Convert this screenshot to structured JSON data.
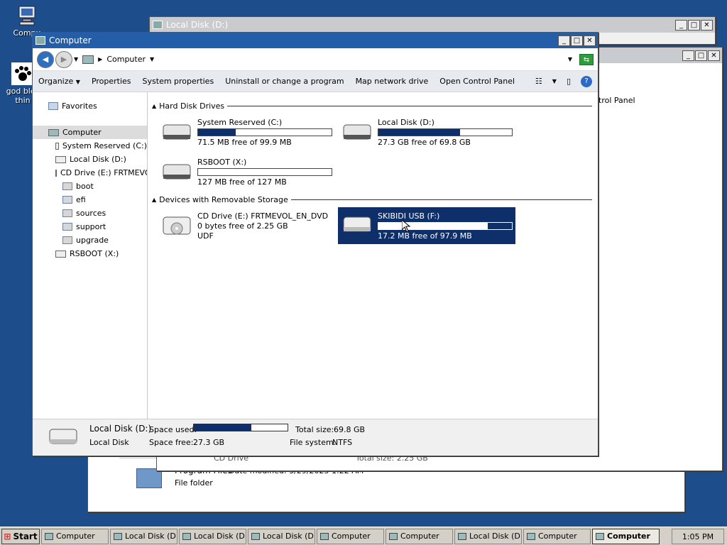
{
  "desktop": {
    "icons": [
      {
        "label": "Compu",
        "icon": "computer-icon"
      },
      {
        "label": "god bles thin",
        "icon": "paw-icon"
      }
    ]
  },
  "bg_windows": {
    "back": {
      "title": "Local Disk (D:)"
    },
    "middle_hidden_text": {
      "control_panel": "trol Panel"
    },
    "bottom": {
      "cd_drive": "CD Drive",
      "total_size": "Total size: 2.25 GB",
      "folder_name": "Program Files",
      "date_modified": "Date modified: 3/29/2025 1:22 AM",
      "folder_type": "File folder"
    }
  },
  "window": {
    "title": "Computer",
    "address": "Computer",
    "toolbar": {
      "organize": "Organize",
      "properties": "Properties",
      "system_properties": "System properties",
      "uninstall": "Uninstall or change a program",
      "map_drive": "Map network drive",
      "control_panel": "Open Control Panel"
    },
    "nav": {
      "favorites": "Favorites",
      "computer": "Computer",
      "items": [
        {
          "label": "System Reserved (C:)",
          "indent": 1,
          "kind": "drive"
        },
        {
          "label": "Local Disk (D:)",
          "indent": 1,
          "kind": "drive"
        },
        {
          "label": "CD Drive (E:) FRTMEVOL",
          "indent": 1,
          "kind": "drive"
        },
        {
          "label": "boot",
          "indent": 2,
          "kind": "folder"
        },
        {
          "label": "efi",
          "indent": 2,
          "kind": "folder"
        },
        {
          "label": "sources",
          "indent": 2,
          "kind": "folder"
        },
        {
          "label": "support",
          "indent": 2,
          "kind": "folder"
        },
        {
          "label": "upgrade",
          "indent": 2,
          "kind": "folder"
        },
        {
          "label": "RSBOOT (X:)",
          "indent": 1,
          "kind": "drive"
        }
      ]
    },
    "sections": {
      "hard_disks": "Hard Disk Drives",
      "removable": "Devices with Removable Storage"
    },
    "drives": [
      {
        "name": "System Reserved (C:)",
        "free": "71.5 MB free of 99.9 MB",
        "used_fraction": 0.28
      },
      {
        "name": "Local Disk (D:)",
        "free": "27.3 GB free of 69.8 GB",
        "used_fraction": 0.61
      },
      {
        "name": "RSBOOT (X:)",
        "free": "127 MB free of 127 MB",
        "used_fraction": 0.0
      }
    ],
    "removable": [
      {
        "name": "CD Drive (E:) FRTMEVOL_EN_DVD",
        "free": "0 bytes free of 2.25 GB",
        "fs": "UDF"
      },
      {
        "name": "SKIBIDI USB (F:)",
        "free": "17.2 MB free of 97.9 MB",
        "used_fraction": 0.82
      }
    ],
    "details": {
      "name": "Local Disk (D:)",
      "type": "Local Disk",
      "space_used_label": "Space used:",
      "space_used_fraction": 0.61,
      "space_free_label": "Space free:",
      "space_free": "27.3 GB",
      "total_size_label": "Total size:",
      "total_size": "69.8 GB",
      "fs_label": "File system:",
      "fs": "NTFS"
    }
  },
  "taskbar": {
    "start": "Start",
    "items": [
      {
        "label": "Computer",
        "active": false
      },
      {
        "label": "Local Disk (D:)",
        "active": false
      },
      {
        "label": "Local Disk (D:)",
        "active": false
      },
      {
        "label": "Local Disk (D:)",
        "active": false
      },
      {
        "label": "Computer",
        "active": false
      },
      {
        "label": "Computer",
        "active": false
      },
      {
        "label": "Local Disk (D:)",
        "active": false
      },
      {
        "label": "Computer",
        "active": false
      },
      {
        "label": "Computer",
        "active": true
      }
    ],
    "clock": "1:05 PM"
  }
}
